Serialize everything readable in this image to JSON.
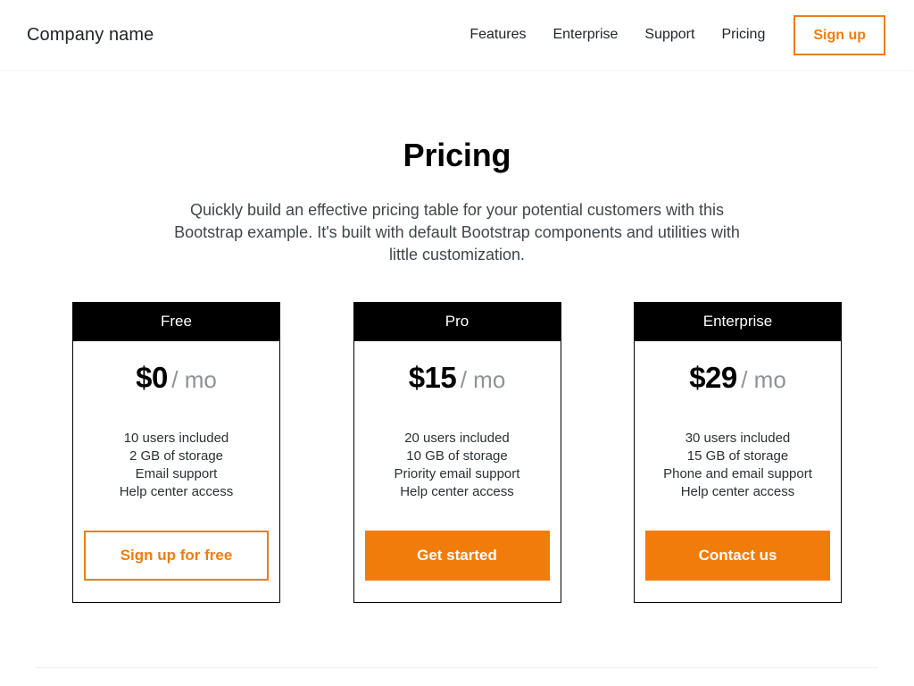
{
  "header": {
    "brand": "Company name",
    "nav_links": [
      {
        "label": "Features"
      },
      {
        "label": "Enterprise"
      },
      {
        "label": "Support"
      },
      {
        "label": "Pricing"
      }
    ],
    "signup_label": "Sign up",
    "accent_color": "#ed7d14"
  },
  "hero": {
    "title": "Pricing",
    "description": "Quickly build an effective pricing table for your potential customers with this Bootstrap example. It's built with default Bootstrap components and utilities with little customization."
  },
  "pricing": {
    "cards": [
      {
        "name": "Free",
        "price": "$0",
        "period": "/ mo",
        "features": [
          "10 users included",
          "2 GB of storage",
          "Email support",
          "Help center access"
        ],
        "cta_label": "Sign up for free",
        "cta_style": "outline"
      },
      {
        "name": "Pro",
        "price": "$15",
        "period": "/ mo",
        "features": [
          "20 users included",
          "10 GB of storage",
          "Priority email support",
          "Help center access"
        ],
        "cta_label": "Get started",
        "cta_style": "solid"
      },
      {
        "name": "Enterprise",
        "price": "$29",
        "period": "/ mo",
        "features": [
          "30 users included",
          "15 GB of storage",
          "Phone and email support",
          "Help center access"
        ],
        "cta_label": "Contact us",
        "cta_style": "solid"
      }
    ]
  },
  "colors": {
    "accent_orange": "#ed7d14",
    "solid_orange": "#f07c0a",
    "card_header_bg": "#000000",
    "page_bg": "#ffffff",
    "divider": "#eeeff1"
  }
}
